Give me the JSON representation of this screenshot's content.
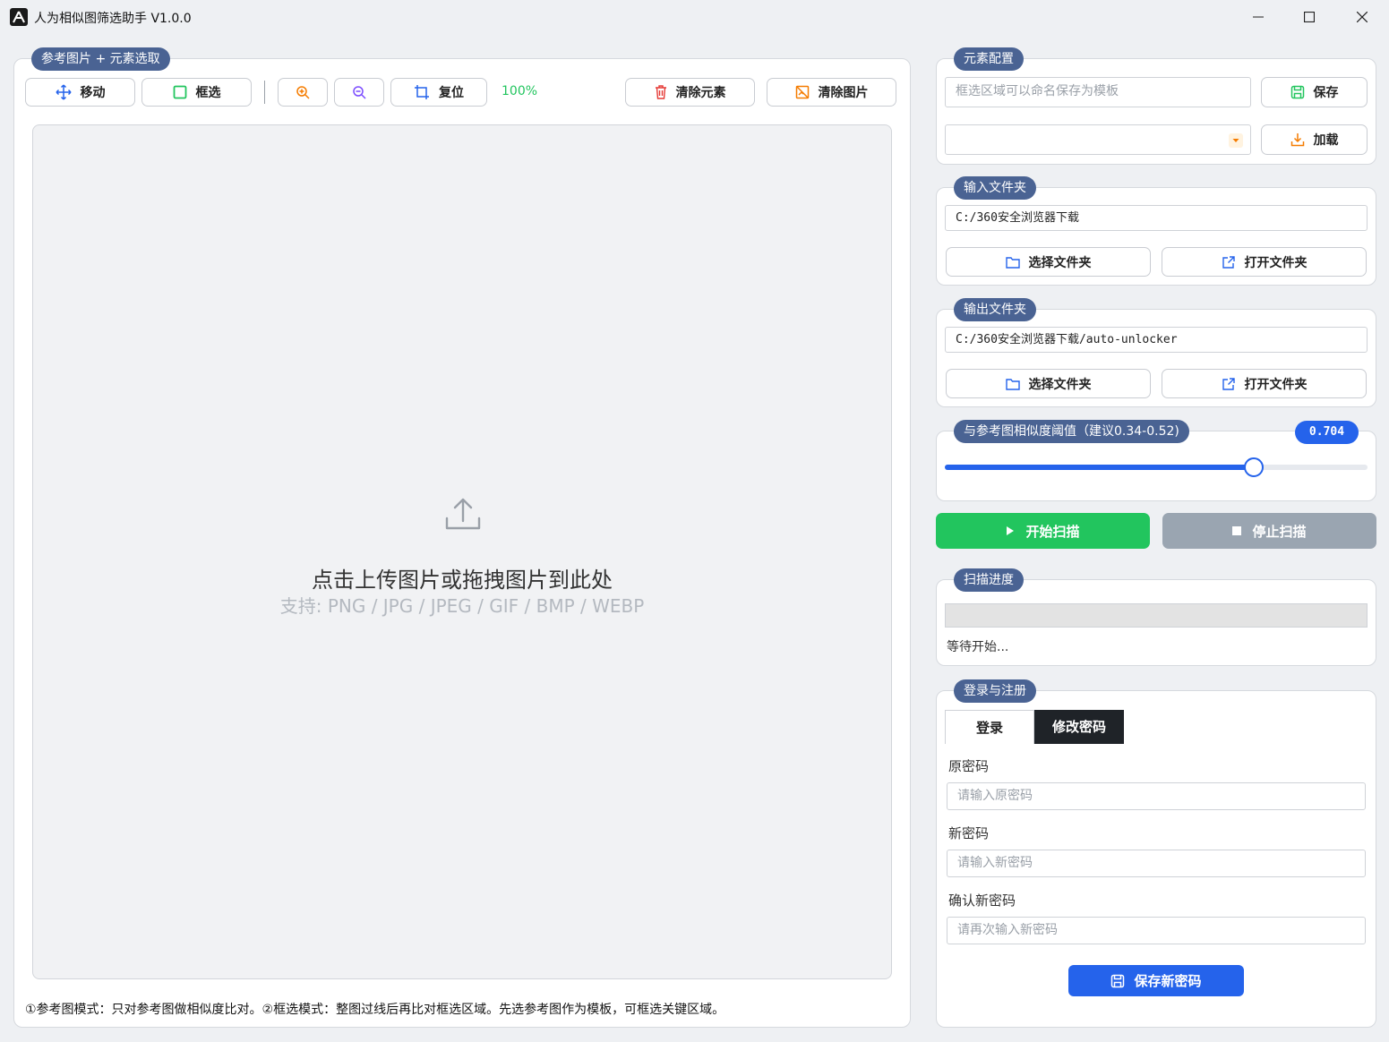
{
  "window": {
    "title": "人为相似图筛选助手 V1.0.0"
  },
  "left_panel": {
    "label": "参考图片 + 元素选取",
    "toolbar": {
      "move": "移动",
      "select": "框选",
      "reset": "复位",
      "zoom": "100%",
      "clear_elements": "清除元素",
      "clear_image": "清除图片"
    },
    "drop_zone": {
      "title": "点击上传图片或拖拽图片到此处",
      "formats": "支持: PNG / JPG / JPEG / GIF / BMP / WEBP"
    },
    "footer_note": "①参考图模式：只对参考图做相似度比对。②框选模式：整图过线后再比对框选区域。先选参考图作为模板，可框选关键区域。"
  },
  "element_config": {
    "label": "元素配置",
    "name_placeholder": "框选区域可以命名保存为模板",
    "save": "保存",
    "load": "加载",
    "template_selected": ""
  },
  "input_folder": {
    "label": "输入文件夹",
    "path": "C:/360安全浏览器下载",
    "choose": "选择文件夹",
    "open": "打开文件夹"
  },
  "output_folder": {
    "label": "输出文件夹",
    "path": "C:/360安全浏览器下载/auto-unlocker",
    "choose": "选择文件夹",
    "open": "打开文件夹"
  },
  "threshold": {
    "label": "与参考图相似度阈值（建议0.34-0.52)",
    "value_text": "0.704",
    "fraction": 0.73
  },
  "actions": {
    "start": "开始扫描",
    "stop": "停止扫描"
  },
  "progress": {
    "label": "扫描进度",
    "status": "等待开始...",
    "fraction": 0
  },
  "account": {
    "label": "登录与注册",
    "tabs": [
      "登录",
      "修改密码"
    ],
    "old_password_label": "原密码",
    "old_password_placeholder": "请输入原密码",
    "new_password_label": "新密码",
    "new_password_placeholder": "请输入新密码",
    "confirm_label": "确认新密码",
    "confirm_placeholder": "请再次输入新密码",
    "submit": "保存新密码"
  },
  "colors": {
    "accent_blue": "#2563eb",
    "pill": "#4a6393",
    "green": "#22c55e",
    "gray_btn": "#9aa5b1",
    "zoom_text": "#22c55e",
    "red_icon": "#e53935",
    "orange_icon": "#f57c00"
  }
}
